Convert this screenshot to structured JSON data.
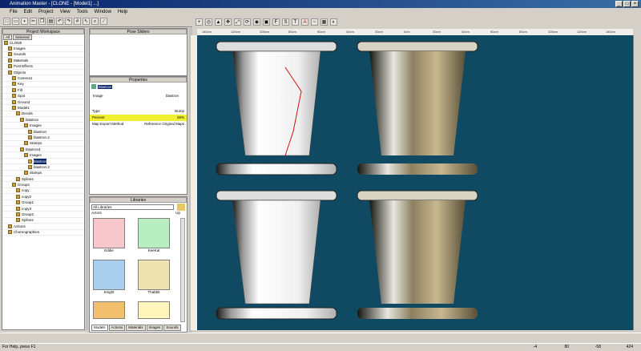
{
  "window": {
    "title": "Animation Master - [CLONE - [Model1] ...]"
  },
  "menu": [
    "File",
    "Edit",
    "Project",
    "View",
    "Tools",
    "Window",
    "Help"
  ],
  "workspace": {
    "title": "Project Workspace",
    "tabs": [
      "All",
      "Selected"
    ],
    "rows": [
      {
        "indent": 0,
        "label": "CLONE"
      },
      {
        "indent": 1,
        "label": "Images"
      },
      {
        "indent": 1,
        "label": "Sounds"
      },
      {
        "indent": 1,
        "label": "Materials"
      },
      {
        "indent": 1,
        "label": "Post Effects"
      },
      {
        "indent": 1,
        "label": "Objects"
      },
      {
        "indent": 2,
        "label": "Camera1"
      },
      {
        "indent": 2,
        "label": "Key"
      },
      {
        "indent": 2,
        "label": "Fill"
      },
      {
        "indent": 2,
        "label": "Spot"
      },
      {
        "indent": 2,
        "label": "Ground"
      },
      {
        "indent": 2,
        "label": "Model1"
      },
      {
        "indent": 3,
        "label": "Decals"
      },
      {
        "indent": 4,
        "label": "blastron"
      },
      {
        "indent": 5,
        "label": "Images"
      },
      {
        "indent": 6,
        "label": "blastron"
      },
      {
        "indent": 6,
        "label": "blastron.2"
      },
      {
        "indent": 5,
        "label": "Stamps"
      },
      {
        "indent": 4,
        "label": "blastron4"
      },
      {
        "indent": 5,
        "label": "Images"
      },
      {
        "indent": 6,
        "label": "blastron",
        "selected": true
      },
      {
        "indent": 6,
        "label": "blastron.2"
      },
      {
        "indent": 5,
        "label": "Stamps"
      },
      {
        "indent": 3,
        "label": "Splines"
      },
      {
        "indent": 2,
        "label": "Groups"
      },
      {
        "indent": 3,
        "label": "copy"
      },
      {
        "indent": 3,
        "label": "copy2"
      },
      {
        "indent": 3,
        "label": "Group1"
      },
      {
        "indent": 3,
        "label": "copy3"
      },
      {
        "indent": 3,
        "label": "Group2"
      },
      {
        "indent": 3,
        "label": "Splines"
      },
      {
        "indent": 1,
        "label": "Actions"
      },
      {
        "indent": 1,
        "label": "Choreographies"
      }
    ]
  },
  "pose_sliders": {
    "title": "Pose Sliders"
  },
  "properties": {
    "title": "Properties",
    "selected_name": "blastron",
    "image_label": "Image",
    "image_value": "blastron",
    "rows": [
      {
        "k": "Type",
        "v": "Bump"
      },
      {
        "k": "Percent",
        "v": "25%",
        "highlight": true
      },
      {
        "k": "Map Export Method",
        "v": "Reference Original Maps"
      }
    ]
  },
  "libraries": {
    "title": "Libraries",
    "dropdown": "All Libraries",
    "up": "Up",
    "sub": "Actors",
    "items": [
      "Eddie",
      "KeeKat",
      "Knight",
      "Thabbit"
    ],
    "thumb_colors": [
      "#f7c7cc",
      "#b7eec2",
      "#aacfee",
      "#eee3b0",
      "#f2c06c",
      "#fff6bb"
    ],
    "tabs": [
      "Models",
      "Actions",
      "Materials",
      "Images",
      "Sounds"
    ]
  },
  "rulers": [
    "140cm",
    "120cm",
    "100cm",
    "80cm",
    "60cm",
    "40cm",
    "20cm",
    "0cm",
    "20cm",
    "40cm",
    "60cm",
    "80cm",
    "100cm",
    "120cm",
    "140cm"
  ],
  "status": {
    "help": "For Help, press F1",
    "fields": [
      "-4",
      "80",
      "-58",
      "424"
    ]
  }
}
